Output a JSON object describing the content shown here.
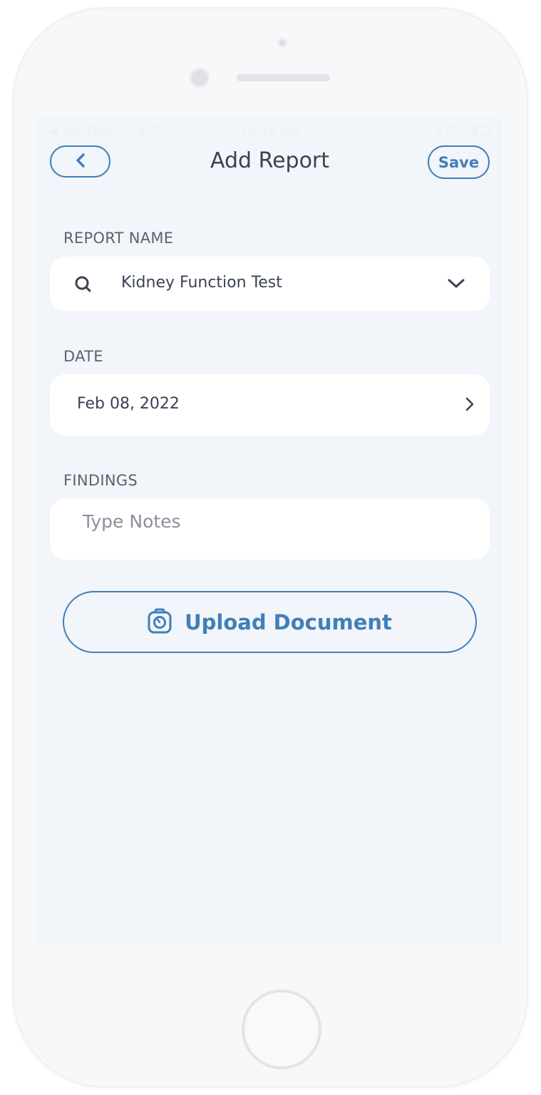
{
  "status_bar": {
    "left": "◀ TestFlight",
    "time": "10:18 AM",
    "battery": "27%"
  },
  "header": {
    "title": "Add Report",
    "save_label": "Save"
  },
  "form": {
    "report_name": {
      "label": "REPORT NAME",
      "value": "Kidney Function Test"
    },
    "date": {
      "label": "DATE",
      "value": "Feb 08, 2022"
    },
    "findings": {
      "label": "FINDINGS",
      "placeholder": "Type Notes"
    }
  },
  "upload": {
    "label": "Upload Document"
  },
  "colors": {
    "accent": "#3f7fba",
    "background": "#f2f5f9",
    "card": "#ffffff",
    "text": "#3a4252"
  }
}
